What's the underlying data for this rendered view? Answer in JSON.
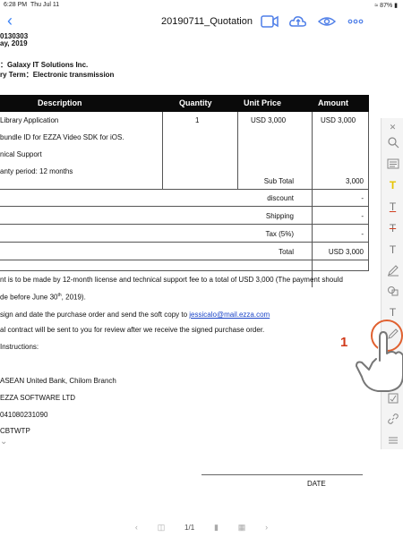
{
  "status_bar": {
    "time": "6:28 PM",
    "date": "Thu Jul 11",
    "wifi": "wifi-icon",
    "battery": "87%"
  },
  "nav": {
    "back_icon": "chevron-left-icon",
    "title": "20190711_Quotation",
    "icons": [
      "video-icon",
      "cloud-upload-icon",
      "eye-icon",
      "more-icon"
    ]
  },
  "document": {
    "header_partial_lines": [
      "0130303",
      "ay, 2019"
    ],
    "to_line": "：Galaxy IT Solutions Inc.",
    "delivery_line": "ry Term：Electronic transmission",
    "table": {
      "headers": [
        "Description",
        "Quantity",
        "Unit Price",
        "Amount"
      ],
      "desc_lines": [
        "Library Application",
        "bundle ID for EZZA Video SDK for iOS.",
        "nical Support",
        "anty period: 12 months"
      ],
      "quantity": "1",
      "unit_price": "USD 3,000",
      "amount": "USD 3,000",
      "summary": [
        {
          "label": "Sub  Total",
          "value": "3,000"
        },
        {
          "label": "discount",
          "value": "-"
        },
        {
          "label": "Shipping",
          "value": "-"
        },
        {
          "label": "Tax (5%)",
          "value": "-"
        },
        {
          "label": "Total",
          "value": "USD  3,000"
        }
      ]
    },
    "notes": {
      "payment_line": "nt is to be made by 12-month license and technical support fee to a total of USD 3,000 (The payment should",
      "deadline_line": "de before June 30",
      "deadline_sup": "th",
      "deadline_end": ", 2019).",
      "sign_line": "sign and date the purchase order and send the soft copy to",
      "email": "jessicalo@mail.ezza.com",
      "contract_line": "al contract will be sent to you for review after we receive the signed purchase order.",
      "instructions_line": "Instructions:",
      "bank_line": "ASEAN United Bank, Chilom Branch",
      "company_line": "EZZA SOFTWARE LTD",
      "account_line": "041080231090",
      "swift_line": "CBTWTP"
    },
    "date_label": "DATE"
  },
  "annotation_toolbar": {
    "tools": [
      "close-icon",
      "search-icon",
      "list-icon",
      "highlight-icon",
      "underline-icon",
      "strikethrough-icon",
      "text-icon",
      "pen-icon",
      "shape-icon",
      "text-box-icon",
      "signature-icon",
      "stamp-icon",
      "attachment-icon",
      "link-icon",
      "menu-icon"
    ]
  },
  "overlay": {
    "step_number": "1"
  },
  "page_bar": {
    "page_indicator": "1/1"
  }
}
